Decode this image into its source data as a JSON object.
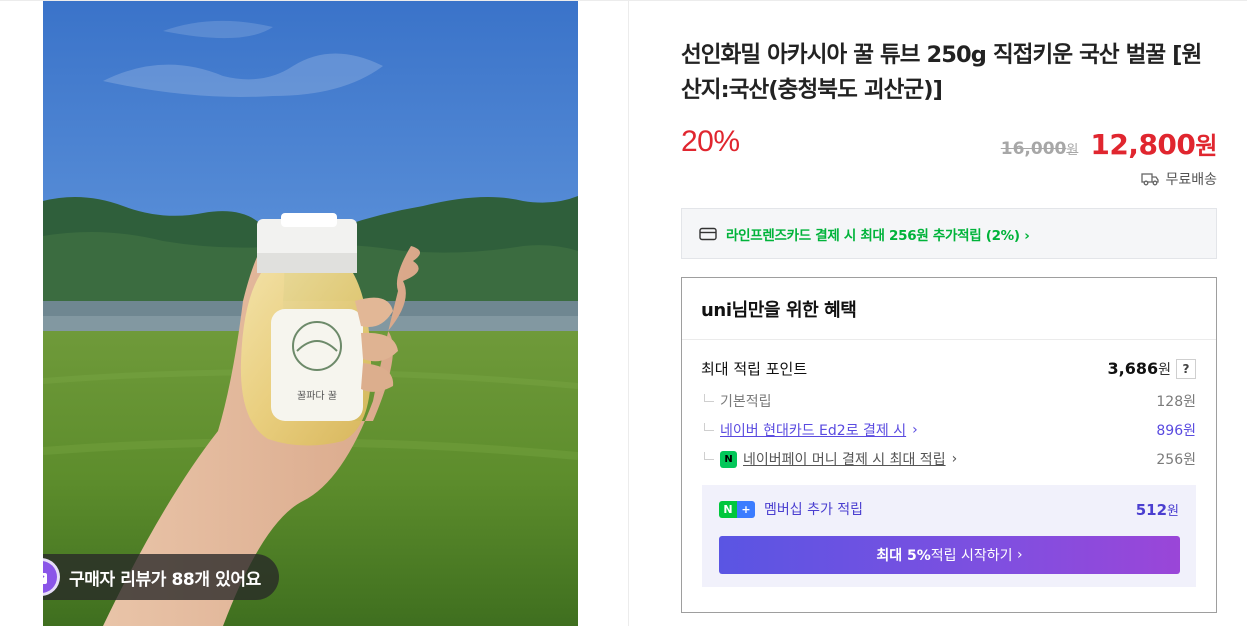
{
  "product": {
    "title": "선인화밀 아카시아 꿀 튜브 250g 직접키운 국산 벌꿀 [원산지:국산(충청북도 괴산군)]",
    "image_alt": "hand holding honey jar in rice field",
    "jar_label_text": "꿀파다 꿀",
    "review_badge": "구매자 리뷰가 88개 있어요"
  },
  "pricing": {
    "discount": "20%",
    "original_price": "16,000",
    "original_unit": "원",
    "sale_price": "12,800",
    "sale_unit": "원",
    "shipping": "무료배송"
  },
  "card_promo": {
    "text": "라인프렌즈카드 결제 시 최대 256원 추가적립 (2%)",
    "chevron": "›"
  },
  "benefits": {
    "heading": "uni님만을 위한 혜택",
    "max_points_label": "최대 적립 포인트",
    "max_points_value": "3,686",
    "max_points_unit": "원",
    "help": "?",
    "items": [
      {
        "label": "기본적립",
        "amount": "128원"
      },
      {
        "label": "네이버 현대카드 Ed2로 결제 시",
        "amount": "896원",
        "chevron": "›"
      },
      {
        "label": "네이버페이 머니 결제 시 최대 적립",
        "amount": "256원",
        "chevron": "›"
      }
    ],
    "npay_icon": "N",
    "membership": {
      "label": "멤버십 추가 적립",
      "value": "512",
      "unit": "원",
      "icon_n": "N",
      "icon_plus": "+"
    },
    "cta": {
      "bold": "최대 5%",
      "rest": " 적립 시작하기",
      "chevron": "›"
    }
  },
  "colors": {
    "discount_red": "#e0262f",
    "naver_green": "#00b33a",
    "member_purple": "#4b3fd0"
  }
}
